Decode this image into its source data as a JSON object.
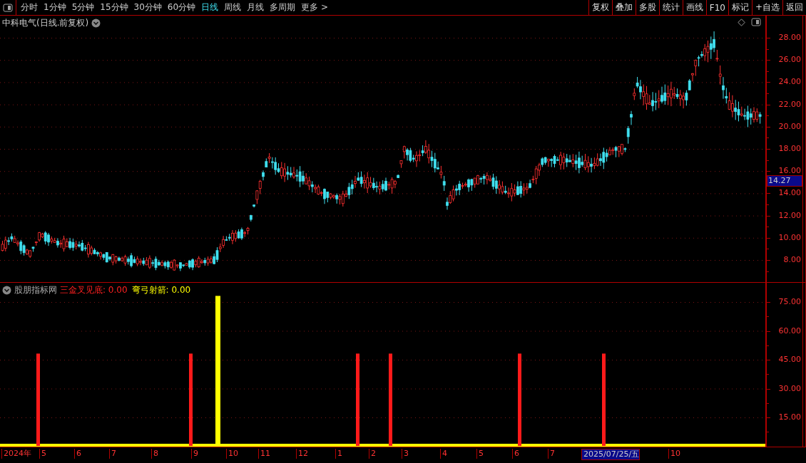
{
  "toolbar": {
    "periods": [
      {
        "label": "分时",
        "selected": false
      },
      {
        "label": "1分钟",
        "selected": false
      },
      {
        "label": "5分钟",
        "selected": false
      },
      {
        "label": "15分钟",
        "selected": false
      },
      {
        "label": "30分钟",
        "selected": false
      },
      {
        "label": "60分钟",
        "selected": false
      },
      {
        "label": "日线",
        "selected": true
      },
      {
        "label": "周线",
        "selected": false
      },
      {
        "label": "月线",
        "selected": false
      },
      {
        "label": "多周期",
        "selected": false
      },
      {
        "label": "更多 >",
        "selected": false
      }
    ],
    "buttons": [
      "复权",
      "叠加",
      "多股",
      "统计",
      "画线",
      "F10",
      "标记",
      "+自选",
      "返回"
    ]
  },
  "price_panel": {
    "title": "中科电气(日线.前复权)",
    "y_axis": [
      "28.00",
      "26.00",
      "24.00",
      "22.00",
      "20.00",
      "18.00",
      "16.00",
      "14.00",
      "12.00",
      "10.00",
      "8.00"
    ],
    "price_tag": "14.27"
  },
  "indicator_panel": {
    "source": "股朋指标网",
    "legend": [
      {
        "label": "三金叉见底: 0.00",
        "color": "#ff2020"
      },
      {
        "label": "弯弓射箭: 0.00",
        "color": "#ffff00"
      }
    ],
    "y_axis": [
      "75.00",
      "60.00",
      "45.00",
      "30.00",
      "15.00"
    ]
  },
  "date_axis": [
    {
      "label": "2024年",
      "selected": false
    },
    {
      "label": "5",
      "selected": false
    },
    {
      "label": "6",
      "selected": false
    },
    {
      "label": "7",
      "selected": false
    },
    {
      "label": "8",
      "selected": false
    },
    {
      "label": "9",
      "selected": false
    },
    {
      "label": "10",
      "selected": false
    },
    {
      "label": "11",
      "selected": false
    },
    {
      "label": "12",
      "selected": false
    },
    {
      "label": "1",
      "selected": false
    },
    {
      "label": "2",
      "selected": false
    },
    {
      "label": "3",
      "selected": false
    },
    {
      "label": "4",
      "selected": false
    },
    {
      "label": "5",
      "selected": false
    },
    {
      "label": "6",
      "selected": false
    },
    {
      "label": "7",
      "selected": false
    },
    {
      "label": "2025/07/25/五",
      "selected": true
    },
    {
      "label": "10",
      "selected": false
    }
  ]
}
